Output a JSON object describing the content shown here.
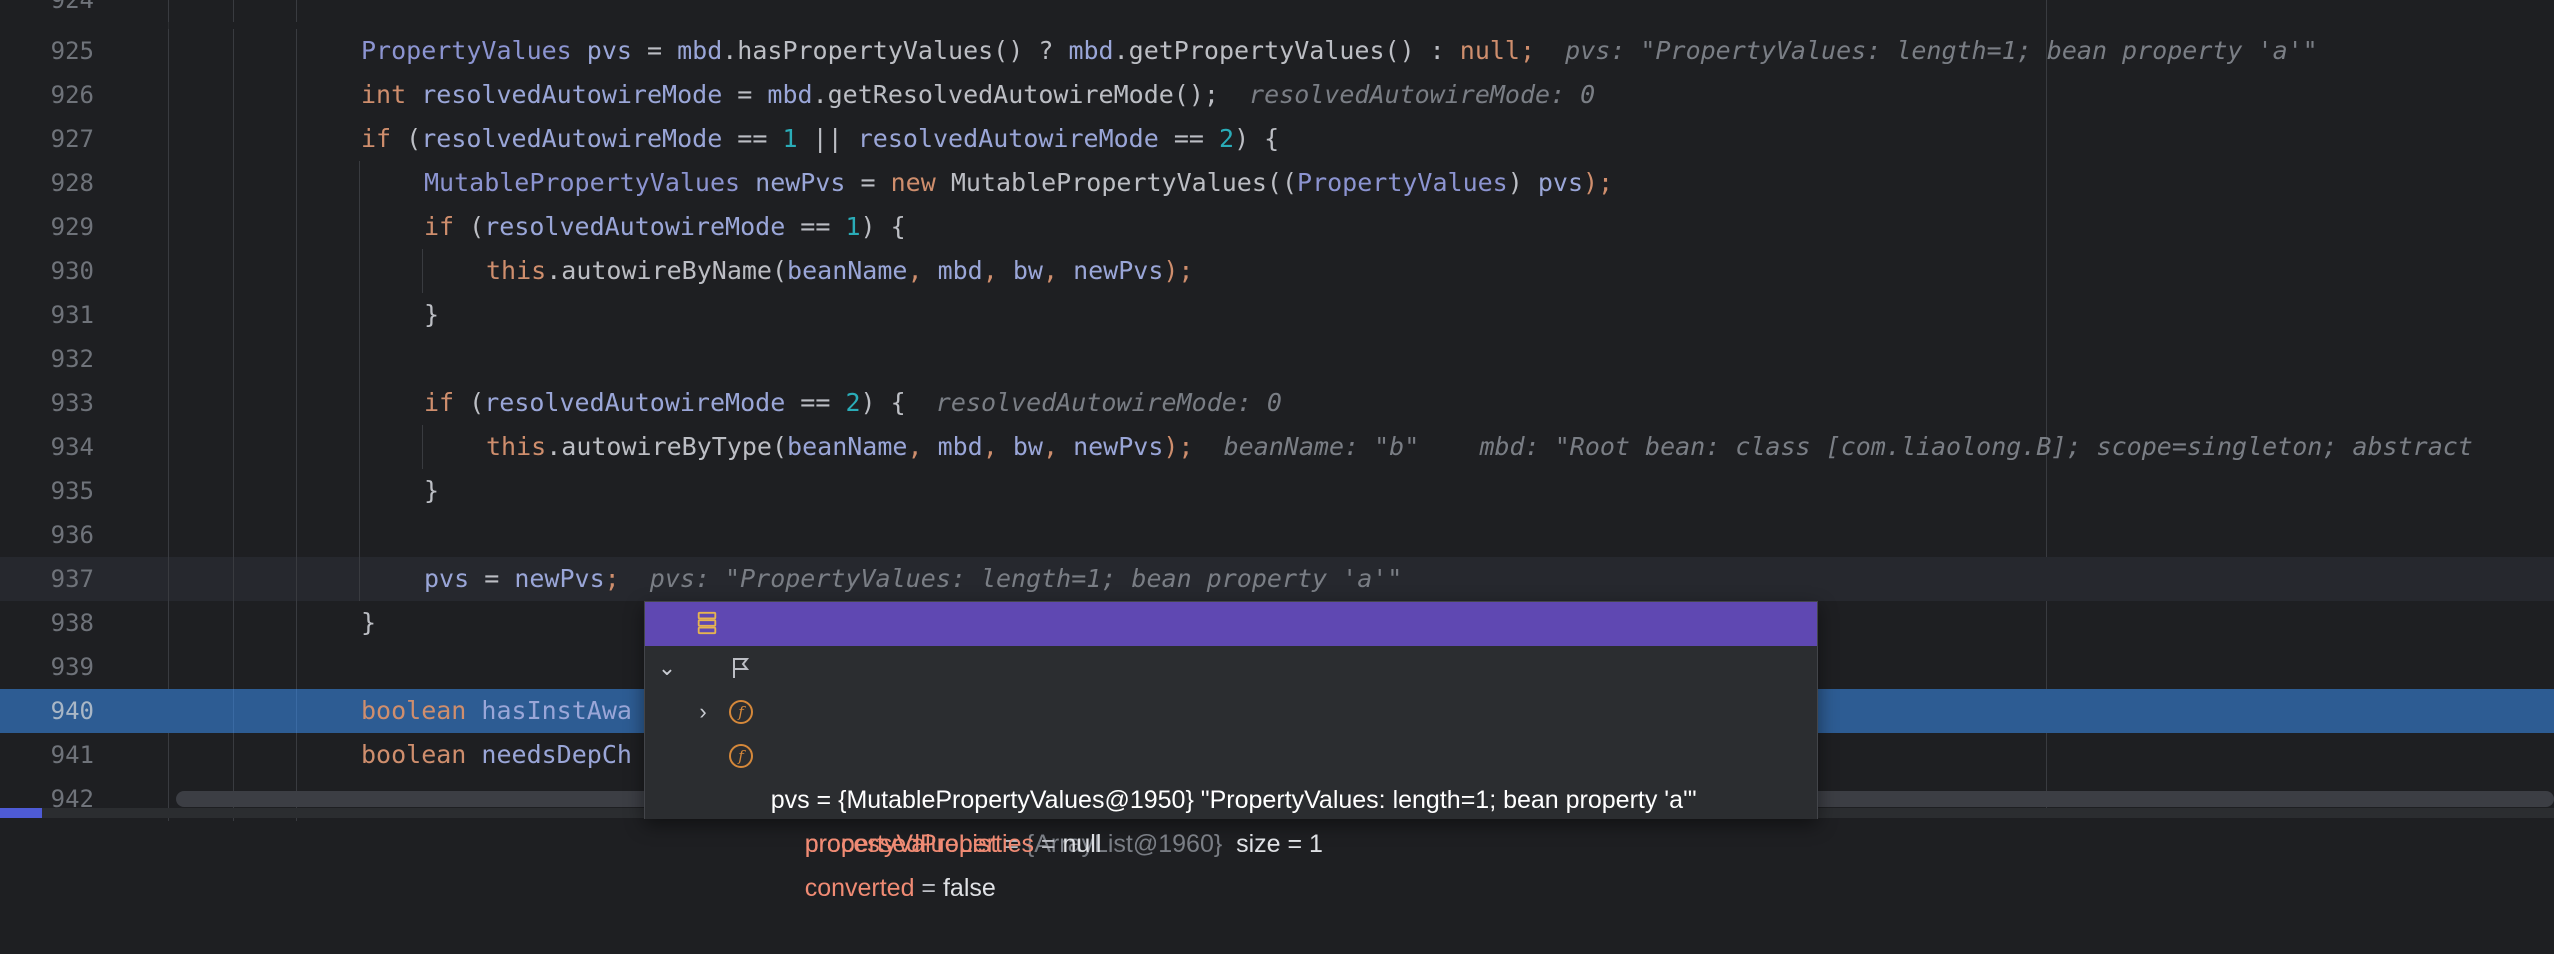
{
  "editor": {
    "lines": [
      {
        "num": "924",
        "tokens": []
      },
      {
        "num": "925",
        "tokens": [
          {
            "t": "PropertyValues ",
            "c": "ty"
          },
          {
            "t": "pvs",
            "c": "v"
          },
          {
            "t": " = ",
            "c": "pl"
          },
          {
            "t": "mbd",
            "c": "v"
          },
          {
            "t": ".hasPropertyValues() ? ",
            "c": "pl"
          },
          {
            "t": "mbd",
            "c": "v"
          },
          {
            "t": ".getPropertyValues() : ",
            "c": "pl"
          },
          {
            "t": "null",
            "c": "kw"
          },
          {
            "t": ";",
            "c": "kw"
          },
          {
            "t": "  pvs: \"PropertyValues: length=1; bean property 'a'\"",
            "c": "inl"
          }
        ]
      },
      {
        "num": "926",
        "tokens": [
          {
            "t": "int ",
            "c": "kw"
          },
          {
            "t": "resolvedAutowireMode",
            "c": "v"
          },
          {
            "t": " = ",
            "c": "pl"
          },
          {
            "t": "mbd",
            "c": "v"
          },
          {
            "t": ".getResolvedAutowireMode();",
            "c": "pl"
          },
          {
            "t": "  resolvedAutowireMode: 0",
            "c": "inl"
          }
        ]
      },
      {
        "num": "927",
        "tokens": [
          {
            "t": "if ",
            "c": "kw"
          },
          {
            "t": "(",
            "c": "pl"
          },
          {
            "t": "resolvedAutowireMode",
            "c": "v"
          },
          {
            "t": " == ",
            "c": "pl"
          },
          {
            "t": "1",
            "c": "num"
          },
          {
            "t": " || ",
            "c": "pl"
          },
          {
            "t": "resolvedAutowireMode",
            "c": "v"
          },
          {
            "t": " == ",
            "c": "pl"
          },
          {
            "t": "2",
            "c": "num"
          },
          {
            "t": ") {",
            "c": "pl"
          }
        ]
      },
      {
        "num": "928",
        "tokens": [
          {
            "t": "MutablePropertyValues ",
            "c": "ty"
          },
          {
            "t": "newPvs",
            "c": "v"
          },
          {
            "t": " = ",
            "c": "pl"
          },
          {
            "t": "new ",
            "c": "kw"
          },
          {
            "t": "MutablePropertyValues((",
            "c": "pl"
          },
          {
            "t": "PropertyValues",
            "c": "ty"
          },
          {
            "t": ") ",
            "c": "pl"
          },
          {
            "t": "pvs",
            "c": "v"
          },
          {
            "t": ");",
            "c": "kw"
          }
        ]
      },
      {
        "num": "929",
        "tokens": [
          {
            "t": "if ",
            "c": "kw"
          },
          {
            "t": "(",
            "c": "pl"
          },
          {
            "t": "resolvedAutowireMode",
            "c": "v"
          },
          {
            "t": " == ",
            "c": "pl"
          },
          {
            "t": "1",
            "c": "num"
          },
          {
            "t": ") {",
            "c": "pl"
          }
        ]
      },
      {
        "num": "930",
        "tokens": [
          {
            "t": "this",
            "c": "kw"
          },
          {
            "t": ".autowireByName(",
            "c": "pl"
          },
          {
            "t": "beanName",
            "c": "v"
          },
          {
            "t": ", ",
            "c": "kw"
          },
          {
            "t": "mbd",
            "c": "v"
          },
          {
            "t": ", ",
            "c": "kw"
          },
          {
            "t": "bw",
            "c": "v"
          },
          {
            "t": ", ",
            "c": "kw"
          },
          {
            "t": "newPvs",
            "c": "v"
          },
          {
            "t": ");",
            "c": "kw"
          }
        ]
      },
      {
        "num": "931",
        "tokens": [
          {
            "t": "}",
            "c": "pl"
          }
        ]
      },
      {
        "num": "932",
        "tokens": []
      },
      {
        "num": "933",
        "tokens": [
          {
            "t": "if ",
            "c": "kw"
          },
          {
            "t": "(",
            "c": "pl"
          },
          {
            "t": "resolvedAutowireMode",
            "c": "v"
          },
          {
            "t": " == ",
            "c": "pl"
          },
          {
            "t": "2",
            "c": "num"
          },
          {
            "t": ") {",
            "c": "pl"
          },
          {
            "t": "  resolvedAutowireMode: 0",
            "c": "inl"
          }
        ]
      },
      {
        "num": "934",
        "tokens": [
          {
            "t": "this",
            "c": "kw"
          },
          {
            "t": ".autowireByType(",
            "c": "pl"
          },
          {
            "t": "beanName",
            "c": "v"
          },
          {
            "t": ", ",
            "c": "kw"
          },
          {
            "t": "mbd",
            "c": "v"
          },
          {
            "t": ", ",
            "c": "kw"
          },
          {
            "t": "bw",
            "c": "v"
          },
          {
            "t": ", ",
            "c": "kw"
          },
          {
            "t": "newPvs",
            "c": "v"
          },
          {
            "t": ");",
            "c": "kw"
          },
          {
            "t": "  beanName: \"b\"    mbd: \"Root bean: class [com.liaolong.B]; scope=singleton; abstract",
            "c": "inl"
          }
        ]
      },
      {
        "num": "935",
        "tokens": [
          {
            "t": "}",
            "c": "pl"
          }
        ]
      },
      {
        "num": "936",
        "tokens": []
      },
      {
        "num": "937",
        "tokens": [
          {
            "t": "pvs",
            "c": "v"
          },
          {
            "t": " = ",
            "c": "pl"
          },
          {
            "t": "newPvs",
            "c": "v"
          },
          {
            "t": ";",
            "c": "kw"
          },
          {
            "t": "  pvs: \"PropertyValues: length=1; bean property 'a'\"",
            "c": "inl"
          }
        ]
      },
      {
        "num": "938",
        "tokens": [
          {
            "t": "}",
            "c": "pl"
          }
        ]
      },
      {
        "num": "939",
        "tokens": []
      },
      {
        "num": "940",
        "tokens": [
          {
            "t": "boolean ",
            "c": "kw"
          },
          {
            "t": "hasInstAwa",
            "c": "v"
          }
        ]
      },
      {
        "num": "941",
        "tokens": [
          {
            "t": "boolean ",
            "c": "kw"
          },
          {
            "t": "needsDepCh",
            "c": "v"
          }
        ]
      },
      {
        "num": "942",
        "tokens": []
      }
    ]
  },
  "debug_popup": {
    "root": {
      "name": "pvs",
      "eq": " = ",
      "value": "{MutablePropertyValues@1950} \"PropertyValues: length=1; bean property 'a'\""
    },
    "children": [
      {
        "name": "propertyValueList",
        "eq": " = ",
        "id": "{ArrayList@1960}",
        "value": "  size = 1",
        "icon": "flag-icon"
      },
      {
        "name": "processedProperties",
        "eq": " = ",
        "id": "",
        "value": "null",
        "icon": "field-icon"
      },
      {
        "name": "converted",
        "eq": " = ",
        "id": "",
        "value": "false",
        "icon": "field-icon"
      }
    ],
    "field_icon_letter": "f"
  },
  "colors": {
    "background": "#1e1f22",
    "keyword": "#cf8e6d",
    "type": "#8c94d1",
    "number": "#2aacb8",
    "inline_hint": "#7a7e85",
    "selection": "#2d5c93",
    "popup_selected": "#5f48b2"
  }
}
